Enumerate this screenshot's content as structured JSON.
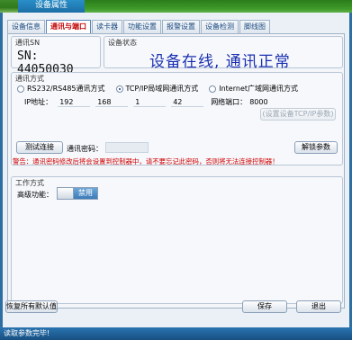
{
  "window": {
    "title": "设备属性"
  },
  "tabs": [
    {
      "label": "设备信息"
    },
    {
      "label": "通讯与端口"
    },
    {
      "label": "读卡器"
    },
    {
      "label": "功能设置"
    },
    {
      "label": "报警设置"
    },
    {
      "label": "设备检测"
    },
    {
      "label": "脚线图"
    }
  ],
  "active_tab": 1,
  "sn": {
    "label": "通讯SN",
    "value": "SN: 44050030"
  },
  "device_status": {
    "label": "设备状态",
    "text": "设备在线, 通讯正常"
  },
  "comm_method": {
    "label": "通讯方式",
    "options": [
      {
        "label": "RS232/RS485通讯方式",
        "checked": false
      },
      {
        "label": "TCP/IP局域网通讯方式",
        "checked": true
      },
      {
        "label": "Internet广域网通讯方式",
        "checked": false
      }
    ],
    "ip_label": "IP地址：",
    "ip": [
      "192",
      "168",
      "1",
      "42"
    ],
    "port_label": "网络端口：",
    "port": "8000",
    "set_ip_button": "(设置设备TCP/IP参数)",
    "test_button": "测试连接",
    "password_label": "通讯密码：",
    "password_value": "",
    "unlock_button": "解锁参数",
    "warning": "警告：通讯密码修改后将会设置到控制器中，请不要忘记此密码，否则将无法连接控制器！"
  },
  "work_mode": {
    "label": "工作方式",
    "advanced_label": "高级功能：",
    "toggle_label": "禁用"
  },
  "footer": {
    "restore_button": "恢复所有默认值",
    "save_button": "保存",
    "exit_button": "退出"
  },
  "statusbar": {
    "text": "读取参数完毕!"
  },
  "colors": {
    "title_bar": "#2f7a1c",
    "tab_title": "#1c6ea6",
    "status_text": "#1a2fb0",
    "warning": "#d00000",
    "statusbar": "#174f82"
  }
}
